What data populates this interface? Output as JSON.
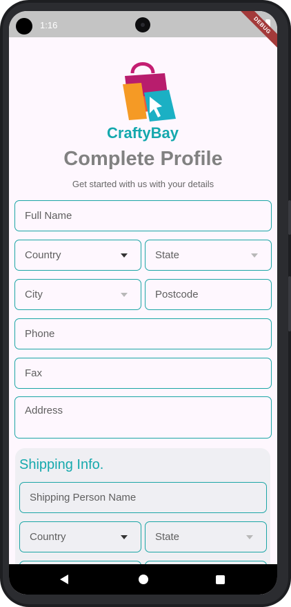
{
  "status_bar": {
    "time": "1:16",
    "debug_label": "DEBUG"
  },
  "brand": {
    "name": "CraftyBay"
  },
  "header": {
    "title": "Complete Profile",
    "subtitle": "Get started with us with your details"
  },
  "form": {
    "full_name": "Full Name",
    "country": "Country",
    "state": "State",
    "city": "City",
    "postcode": "Postcode",
    "phone": "Phone",
    "fax": "Fax",
    "address": "Address"
  },
  "shipping": {
    "title": "Shipping Info.",
    "person_name": "Shipping Person Name",
    "country": "Country",
    "state": "State"
  },
  "colors": {
    "accent": "#1aa5a5",
    "shipping_title": "#16a9ad",
    "title": "#818181"
  }
}
